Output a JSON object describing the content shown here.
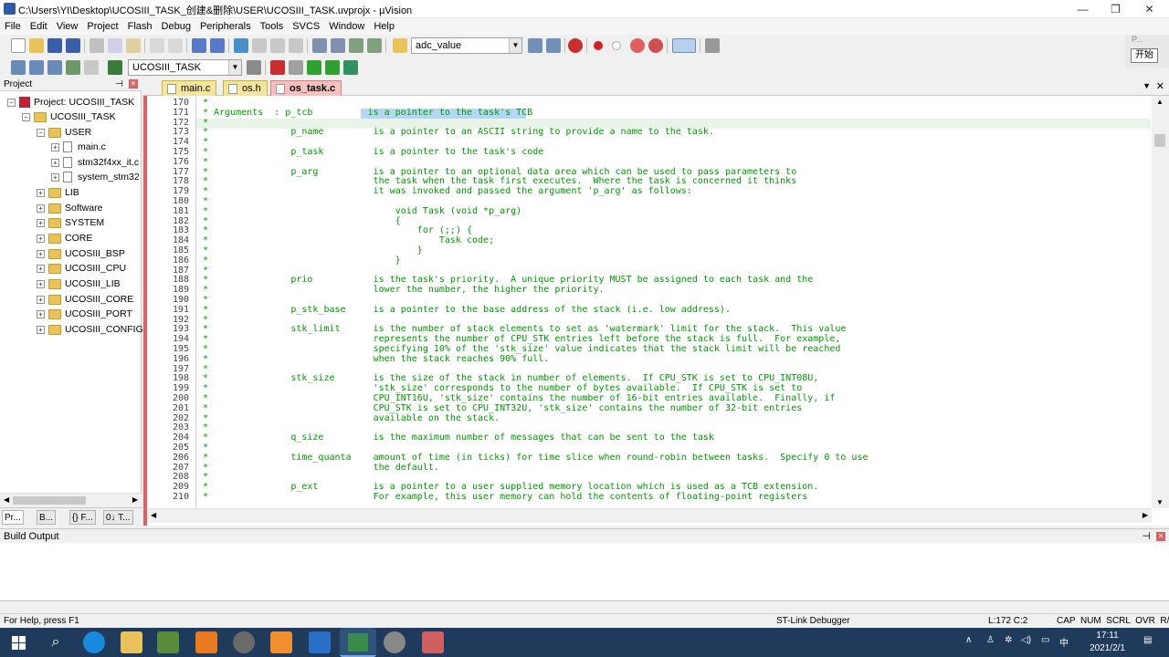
{
  "window": {
    "title": "C:\\Users\\YI\\Desktop\\UCOSIII_TASK_创建&删除\\USER\\UCOSIII_TASK.uvprojx - µVision",
    "minimize": "—",
    "maximize": "❐",
    "close": "✕"
  },
  "menu": [
    "File",
    "Edit",
    "View",
    "Project",
    "Flash",
    "Debug",
    "Peripherals",
    "Tools",
    "SVCS",
    "Window",
    "Help"
  ],
  "toolbar": {
    "find_combo": "adc_value",
    "target_combo": "UCOSIII_TASK",
    "right_label": "P...",
    "start_button": "开始"
  },
  "project": {
    "header": "Project",
    "root": "Project: UCOSIII_TASK",
    "target": "UCOSIII_TASK",
    "groups": [
      {
        "name": "USER",
        "expanded": true
      },
      {
        "name": "LIB",
        "expanded": false
      },
      {
        "name": "Software",
        "expanded": false
      },
      {
        "name": "SYSTEM",
        "expanded": false
      },
      {
        "name": "CORE",
        "expanded": false
      },
      {
        "name": "UCOSIII_BSP",
        "expanded": false
      },
      {
        "name": "UCOSIII_CPU",
        "expanded": false
      },
      {
        "name": "UCOSIII_LIB",
        "expanded": false
      },
      {
        "name": "UCOSIII_CORE",
        "expanded": false
      },
      {
        "name": "UCOSIII_PORT",
        "expanded": false
      },
      {
        "name": "UCOSIII_CONFIG",
        "expanded": false
      }
    ],
    "files": [
      "main.c",
      "stm32f4xx_it.c",
      "system_stm32"
    ],
    "tabs": [
      "Pr...",
      "B...",
      "{} F...",
      "0↓ T..."
    ]
  },
  "editor": {
    "tabs": [
      {
        "label": "main.c",
        "active": false
      },
      {
        "label": "os.h",
        "active": false
      },
      {
        "label": "os_task.c",
        "active": true
      }
    ],
    "lines": [
      {
        "n": "170",
        "t": "*"
      },
      {
        "n": "171",
        "t": "* Arguments  : p_tcb          is a pointer to the task's TCB"
      },
      {
        "n": "172",
        "t": "*"
      },
      {
        "n": "173",
        "t": "*               p_name         is a pointer to an ASCII string to provide a name to the task."
      },
      {
        "n": "174",
        "t": "*"
      },
      {
        "n": "175",
        "t": "*               p_task         is a pointer to the task's code"
      },
      {
        "n": "176",
        "t": "*"
      },
      {
        "n": "177",
        "t": "*               p_arg          is a pointer to an optional data area which can be used to pass parameters to"
      },
      {
        "n": "178",
        "t": "*                              the task when the task first executes.  Where the task is concerned it thinks"
      },
      {
        "n": "179",
        "t": "*                              it was invoked and passed the argument 'p_arg' as follows:"
      },
      {
        "n": "180",
        "t": "*"
      },
      {
        "n": "181",
        "t": "*                                  void Task (void *p_arg)"
      },
      {
        "n": "182",
        "t": "*                                  {"
      },
      {
        "n": "183",
        "t": "*                                      for (;;) {"
      },
      {
        "n": "184",
        "t": "*                                          Task code;"
      },
      {
        "n": "185",
        "t": "*                                      }"
      },
      {
        "n": "186",
        "t": "*                                  }"
      },
      {
        "n": "187",
        "t": "*"
      },
      {
        "n": "188",
        "t": "*               prio           is the task's priority.  A unique priority MUST be assigned to each task and the"
      },
      {
        "n": "189",
        "t": "*                              lower the number, the higher the priority."
      },
      {
        "n": "190",
        "t": "*"
      },
      {
        "n": "191",
        "t": "*               p_stk_base     is a pointer to the base address of the stack (i.e. low address)."
      },
      {
        "n": "192",
        "t": "*"
      },
      {
        "n": "193",
        "t": "*               stk_limit      is the number of stack elements to set as 'watermark' limit for the stack.  This value"
      },
      {
        "n": "194",
        "t": "*                              represents the number of CPU_STK entries left before the stack is full.  For example,"
      },
      {
        "n": "195",
        "t": "*                              specifying 10% of the 'stk_size' value indicates that the stack limit will be reached"
      },
      {
        "n": "196",
        "t": "*                              when the stack reaches 90% full."
      },
      {
        "n": "197",
        "t": "*"
      },
      {
        "n": "198",
        "t": "*               stk_size       is the size of the stack in number of elements.  If CPU_STK is set to CPU_INT08U,"
      },
      {
        "n": "199",
        "t": "*                              'stk_size' corresponds to the number of bytes available.  If CPU_STK is set to"
      },
      {
        "n": "200",
        "t": "*                              CPU_INT16U, 'stk_size' contains the number of 16-bit entries available.  Finally, if"
      },
      {
        "n": "201",
        "t": "*                              CPU_STK is set to CPU_INT32U, 'stk_size' contains the number of 32-bit entries"
      },
      {
        "n": "202",
        "t": "*                              available on the stack."
      },
      {
        "n": "203",
        "t": "*"
      },
      {
        "n": "204",
        "t": "*               q_size         is the maximum number of messages that can be sent to the task"
      },
      {
        "n": "205",
        "t": "*"
      },
      {
        "n": "206",
        "t": "*               time_quanta    amount of time (in ticks) for time slice when round-robin between tasks.  Specify 0 to use"
      },
      {
        "n": "207",
        "t": "*                              the default."
      },
      {
        "n": "208",
        "t": "*"
      },
      {
        "n": "209",
        "t": "*               p_ext          is a pointer to a user supplied memory location which is used as a TCB extension."
      },
      {
        "n": "210",
        "t": "*                              For example, this user memory can hold the contents of floating-point registers"
      }
    ]
  },
  "build_output": {
    "header": "Build Output"
  },
  "status": {
    "help": "For Help, press F1",
    "debugger": "ST-Link Debugger",
    "position": "L:172 C:2",
    "flags": "CAP  NUM  SCRL  OVR  R/O"
  },
  "taskbar": {
    "time": "17:11",
    "date": "2021/2/1"
  }
}
